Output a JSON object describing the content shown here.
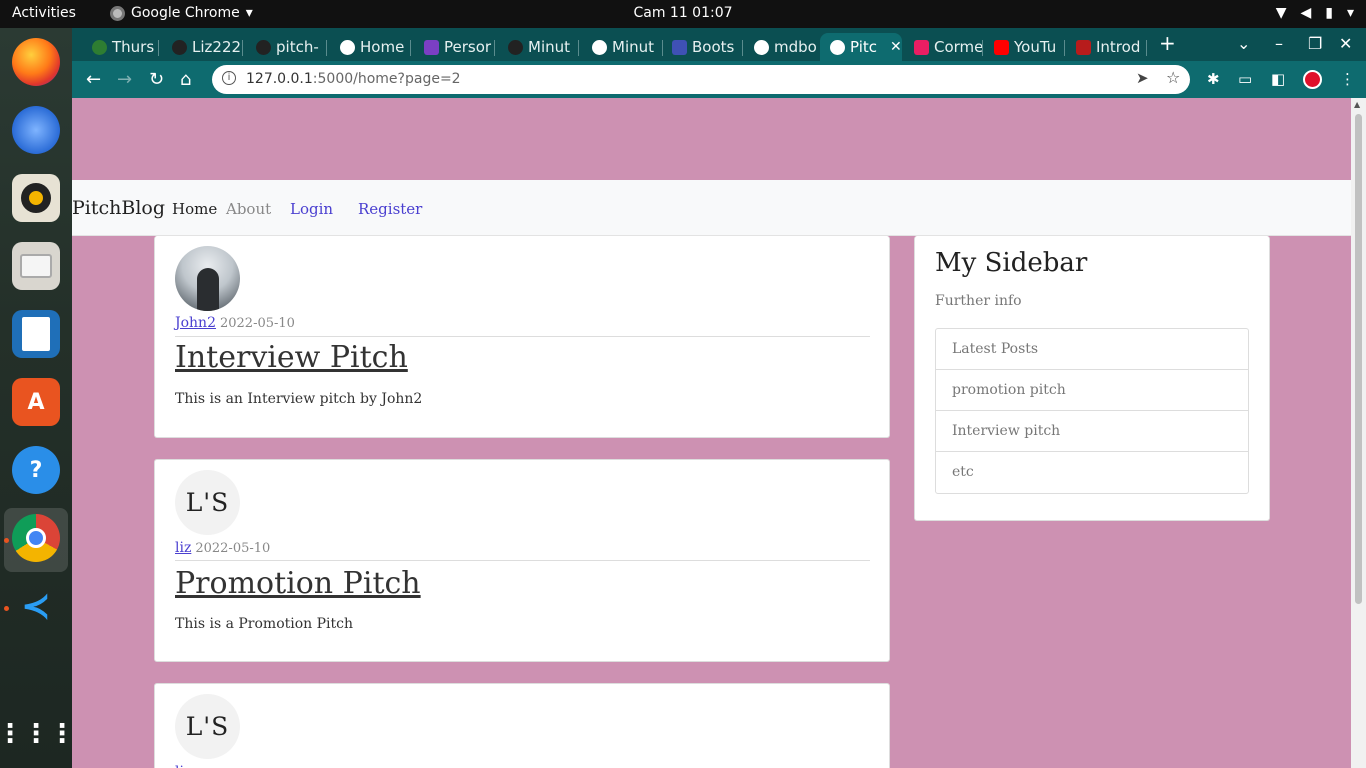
{
  "system": {
    "activities": "Activities",
    "app_name": "Google Chrome",
    "clock": "Cam 11  01:07"
  },
  "browser": {
    "tabs": [
      {
        "label": "Thurs",
        "color": "#2e7d32"
      },
      {
        "label": "Liz222",
        "color": "#222222"
      },
      {
        "label": "pitch-",
        "color": "#222222"
      },
      {
        "label": "Home",
        "color": "#ffffff"
      },
      {
        "label": "Persor",
        "color": "#7b3fc4"
      },
      {
        "label": "Minut",
        "color": "#222222"
      },
      {
        "label": "Minut",
        "color": "#ffffff"
      },
      {
        "label": "Boots",
        "color": "#3f51b5"
      },
      {
        "label": "mdbo",
        "color": "#ffffff"
      },
      {
        "label": "Pitc",
        "color": "#ffffff",
        "active": true
      },
      {
        "label": "Corme",
        "color": "#e91e63"
      },
      {
        "label": "YouTu",
        "color": "#ff0000"
      },
      {
        "label": "Introd",
        "color": "#b71c1c"
      }
    ],
    "url_host": "127.0.0.1",
    "url_rest": ":5000/home?page=2"
  },
  "site": {
    "brand": "PitchBlog",
    "nav": {
      "home": "Home",
      "about": "About",
      "login": "Login",
      "register": "Register"
    },
    "posts": [
      {
        "author": "John2",
        "date": "2022-05-10",
        "title": "Interview Pitch",
        "body": "This is an Interview pitch by John2"
      },
      {
        "author": "liz",
        "date": "2022-05-10",
        "title": "Promotion Pitch",
        "body": "This is a Promotion Pitch",
        "avatar_text": "L'S"
      },
      {
        "author": "li",
        "avatar_text": "L'S"
      }
    ],
    "sidebar": {
      "title": "My Sidebar",
      "subtitle": "Further info",
      "items": [
        "Latest Posts",
        "promotion pitch",
        "Interview pitch",
        "etc"
      ]
    }
  }
}
